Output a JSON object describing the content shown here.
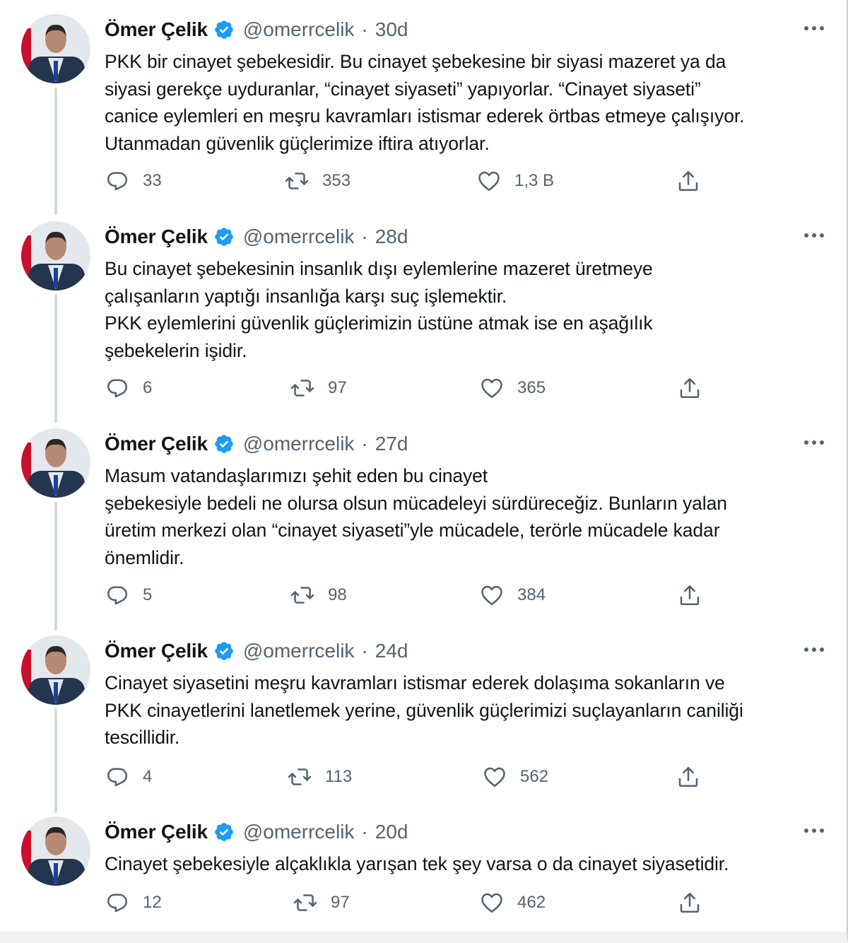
{
  "colors": {
    "verified": "#1d9bf0",
    "icon": "#536471",
    "thread_line": "#cfd9de"
  },
  "tweets": [
    {
      "name": "Ömer Çelik",
      "handle": "@omerrcelik",
      "separator": "·",
      "time": "30d",
      "text": "PKK bir cinayet şebekesidir. Bu cinayet şebekesine bir siyasi mazeret ya da\nsiyasi gerekçe uyduranlar, “cinayet siyaseti” yapıyorlar.  “Cinayet siyaseti”\ncanice eylemleri en meşru kavramları istismar ederek örtbas etmeye çalışıyor.\nUtanmadan güvenlik güçlerimize iftira atıyorlar.",
      "replies": "33",
      "retweets": "353",
      "likes": "1,3 B"
    },
    {
      "name": "Ömer Çelik",
      "handle": "@omerrcelik",
      "separator": "·",
      "time": "28d",
      "text": "Bu cinayet şebekesinin insanlık dışı eylemlerine mazeret üretmeye\nçalışanların yaptığı insanlığa karşı suç işlemektir.\nPKK eylemlerini güvenlik güçlerimizin üstüne atmak ise en aşağılık\nşebekelerin işidir.",
      "replies": "6",
      "retweets": "97",
      "likes": "365"
    },
    {
      "name": "Ömer Çelik",
      "handle": "@omerrcelik",
      "separator": "·",
      "time": "27d",
      "text": "Masum vatandaşlarımızı şehit eden bu cinayet\nşebekesiyle bedeli ne olursa olsun mücadeleyi sürdüreceğiz. Bunların yalan\nüretim merkezi olan “cinayet siyaseti”yle mücadele, terörle mücadele kadar\nönemlidir.",
      "replies": "5",
      "retweets": "98",
      "likes": "384"
    },
    {
      "name": "Ömer Çelik",
      "handle": "@omerrcelik",
      "separator": "·",
      "time": "24d",
      "text": "Cinayet siyasetini meşru kavramları istismar ederek dolaşıma sokanların ve\nPKK cinayetlerini lanetlemek yerine, güvenlik güçlerimizi suçlayanların caniliği\ntescillidir.",
      "replies": "4",
      "retweets": "113",
      "likes": "562"
    },
    {
      "name": "Ömer Çelik",
      "handle": "@omerrcelik",
      "separator": "·",
      "time": "20d",
      "text": "Cinayet şebekesiyle alçaklıkla yarışan tek şey varsa o da cinayet siyasetidir.",
      "replies": "12",
      "retweets": "97",
      "likes": "462"
    }
  ]
}
